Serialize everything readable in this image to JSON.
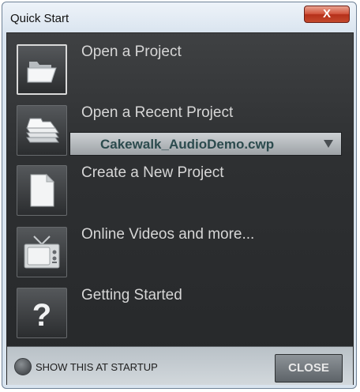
{
  "window": {
    "title": "Quick Start",
    "close_glyph": "X"
  },
  "items": [
    {
      "label": "Open a Project",
      "icon": "folder-icon"
    },
    {
      "label": "Open a Recent Project",
      "icon": "stacked-folders-icon"
    },
    {
      "label": "Create a New Project",
      "icon": "blank-document-icon"
    },
    {
      "label": "Online Videos and more...",
      "icon": "tv-icon"
    },
    {
      "label": "Getting Started",
      "icon": "question-icon"
    }
  ],
  "recent": {
    "selected": "Cakewalk_AudioDemo.cwp"
  },
  "footer": {
    "show_at_startup": "SHOW THIS AT STARTUP",
    "close": "CLOSE"
  },
  "colors": {
    "panel": "#2e3032",
    "item_text": "#d6d6d6",
    "select_text": "#2c4b4e",
    "close_red": "#c4492c"
  }
}
